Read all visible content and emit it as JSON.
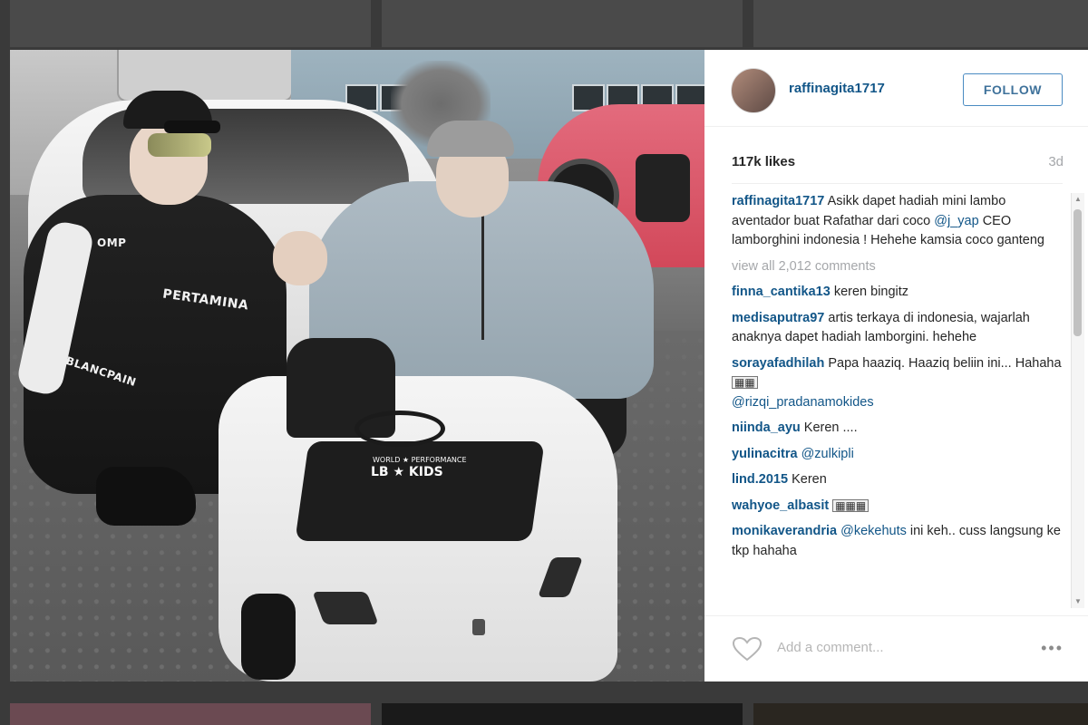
{
  "post": {
    "username": "raffinagita1717",
    "follow_label": "FOLLOW",
    "likes": "117k likes",
    "time_ago": "3d",
    "caption": {
      "username": "raffinagita1717",
      "text_before": "Asikk dapet hadiah mini lambo aventador buat Rafathar dari coco",
      "mention": "@j_yap",
      "text_after": "CEO lamborghini indonesia ! Hehehe kamsia coco ganteng"
    },
    "view_all_comments": "view all 2,012 comments",
    "add_comment_placeholder": "Add a comment...",
    "more_label": "•••"
  },
  "photo_text": {
    "jacket_omp": "OMP",
    "jacket_pertamina": "PERTAMINA",
    "pants_blancpain": "BLANCPAIN",
    "plate_top": "WORLD ★ PERFORMANCE",
    "plate_main": "LB ★ KIDS"
  },
  "comments": [
    {
      "user": "finna_cantika13",
      "text": "keren bingitz",
      "mention": "",
      "emoji": ""
    },
    {
      "user": "medisaputra97",
      "text": "artis terkaya di indonesia, wajarlah anaknya dapet hadiah lamborgini. hehehe",
      "mention": "",
      "emoji": ""
    },
    {
      "user": "sorayafadhilah",
      "text": "Papa haaziq. Haaziq beliin ini... Hahaha",
      "mention": "@rizqi_pradanamokides",
      "emoji": "▦▦"
    },
    {
      "user": "niinda_ayu",
      "text": "Keren ....",
      "mention": "",
      "emoji": ""
    },
    {
      "user": "yulinacitra",
      "text": "",
      "mention": "@zulkipli",
      "emoji": ""
    },
    {
      "user": "lind.2015",
      "text": "Keren",
      "mention": "",
      "emoji": ""
    },
    {
      "user": "wahyoe_albasit",
      "text": "",
      "mention": "",
      "emoji": "▦▦▦"
    },
    {
      "user": "monikaverandria",
      "text": "ini keh.. cuss langsung ke tkp hahaha",
      "mention": "@kekehuts",
      "emoji": ""
    }
  ]
}
